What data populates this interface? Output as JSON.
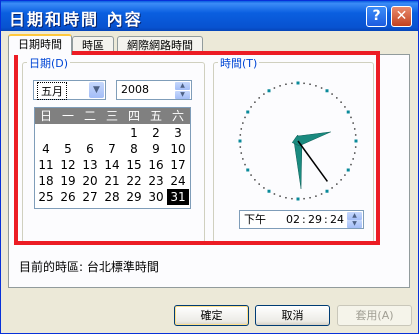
{
  "window": {
    "title": "日期和時間 內容",
    "help_glyph": "?",
    "close_glyph": "✕"
  },
  "tabs": [
    {
      "label": "日期時間",
      "active": true
    },
    {
      "label": "時區",
      "active": false
    },
    {
      "label": "網際網路時間",
      "active": false
    }
  ],
  "date": {
    "group_label": "日期(D)",
    "month": "五月",
    "year": "2008",
    "weekdays": [
      "日",
      "一",
      "二",
      "三",
      "四",
      "五",
      "六"
    ],
    "weeks": [
      [
        "",
        "",
        "",
        "",
        "1",
        "2",
        "3"
      ],
      [
        "4",
        "5",
        "6",
        "7",
        "8",
        "9",
        "10"
      ],
      [
        "11",
        "12",
        "13",
        "14",
        "15",
        "16",
        "17"
      ],
      [
        "18",
        "19",
        "20",
        "21",
        "22",
        "23",
        "24"
      ],
      [
        "25",
        "26",
        "27",
        "28",
        "29",
        "30",
        "31"
      ]
    ],
    "selected_day": "31"
  },
  "time": {
    "group_label": "時間(T)",
    "ampm": "下午",
    "hour": "02",
    "minute": "29",
    "second": "24",
    "clock": {
      "hour": 2,
      "minute": 29,
      "second": 24
    }
  },
  "timezone_text": "目前的時區: 台北標準時間",
  "buttons": {
    "ok": "確定",
    "cancel": "取消",
    "apply": "套用(A)"
  },
  "colors": {
    "titlebar": "#0a5fe0",
    "highlight": "#ec1c24",
    "hand": "#1a8a7f"
  }
}
